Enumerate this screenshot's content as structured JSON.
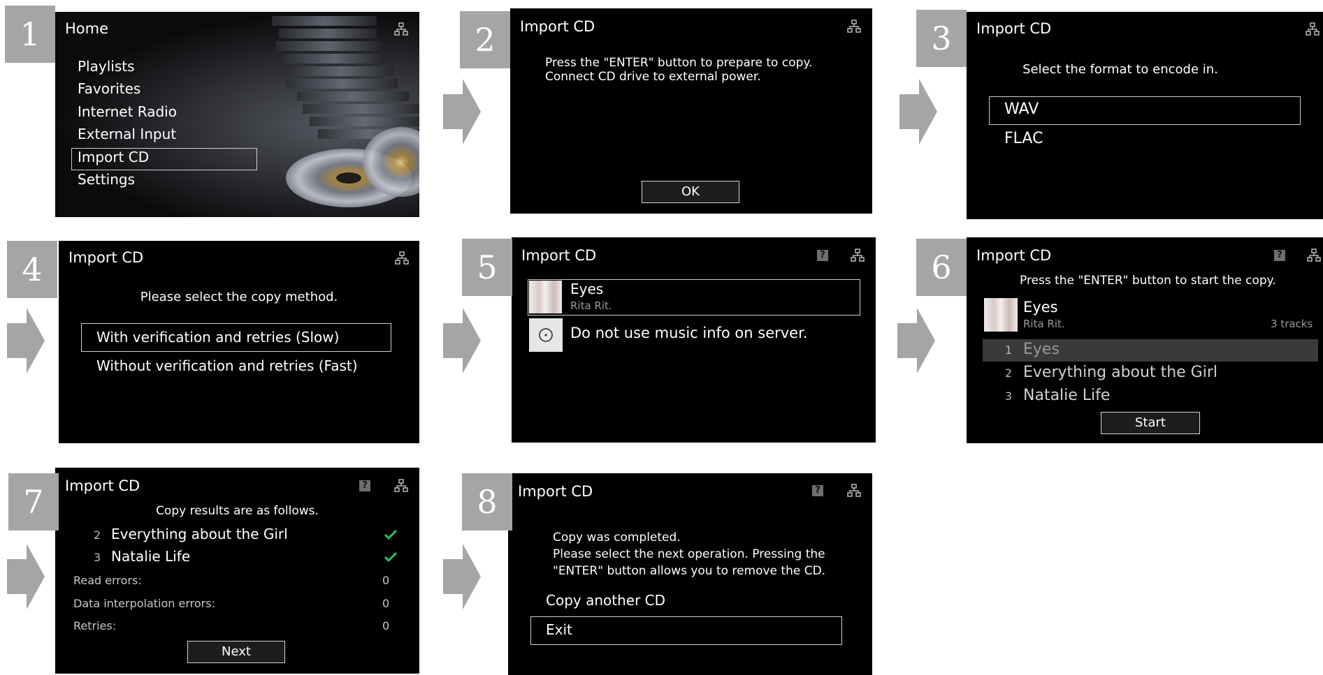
{
  "panel1": {
    "step": "1",
    "title": "Home",
    "menu": [
      "Playlists",
      "Favorites",
      "Internet Radio",
      "External Input",
      "Import CD",
      "Settings"
    ],
    "selected": "Import CD"
  },
  "panel2": {
    "step": "2",
    "title": "Import CD",
    "message": [
      "Press the \"ENTER\" button to prepare to copy.",
      "Connect CD drive to external power."
    ],
    "ok_label": "OK"
  },
  "panel3": {
    "step": "3",
    "title": "Import CD",
    "prompt": "Select the format to encode in.",
    "options": [
      "WAV",
      "FLAC"
    ],
    "selected": "WAV"
  },
  "panel4": {
    "step": "4",
    "title": "Import CD",
    "prompt": "Please select the copy method.",
    "options": [
      "With verification and retries (Slow)",
      "Without verification and retries (Fast)"
    ],
    "selected": "With verification and retries (Slow)"
  },
  "panel5": {
    "step": "5",
    "title": "Import CD",
    "album_title": "Eyes",
    "album_artist": "Rita Rit.",
    "no_info_option": "Do not use music info on server."
  },
  "panel6": {
    "step": "6",
    "title": "Import CD",
    "prompt": "Press the \"ENTER\" button to start the copy.",
    "album_title": "Eyes",
    "album_artist": "Rita Rit.",
    "track_count": "3 tracks",
    "tracks": [
      {
        "num": "1",
        "name": "Eyes"
      },
      {
        "num": "2",
        "name": "Everything about the Girl"
      },
      {
        "num": "3",
        "name": "Natalie Life"
      }
    ],
    "start_label": "Start"
  },
  "panel7": {
    "step": "7",
    "title": "Import CD",
    "prompt": "Copy results are as follows.",
    "tracks": [
      {
        "num": "2",
        "name": "Everything about the Girl"
      },
      {
        "num": "3",
        "name": "Natalie Life"
      }
    ],
    "stats": [
      {
        "label": "Read errors:",
        "value": "0"
      },
      {
        "label": "Data interpolation errors:",
        "value": "0"
      },
      {
        "label": "Retries:",
        "value": "0"
      }
    ],
    "next_label": "Next"
  },
  "panel8": {
    "step": "8",
    "title": "Import CD",
    "message": [
      "Copy was completed.",
      "Please select the next operation. Pressing the",
      "\"ENTER\" button allows you to remove the CD."
    ],
    "options": [
      "Copy another CD",
      "Exit"
    ],
    "selected": "Exit"
  },
  "icons": {
    "network": "network-icon",
    "help": "help-icon",
    "check": "checkmark-icon",
    "disc": "disc-icon",
    "arrow": "next-step-arrow"
  },
  "colors": {
    "screen_bg": "#000000",
    "step_badge": "#a5a5a5",
    "arrow": "#a5a5a5",
    "check": "#2ec05a",
    "highlight_row": "#3a3a3a"
  }
}
